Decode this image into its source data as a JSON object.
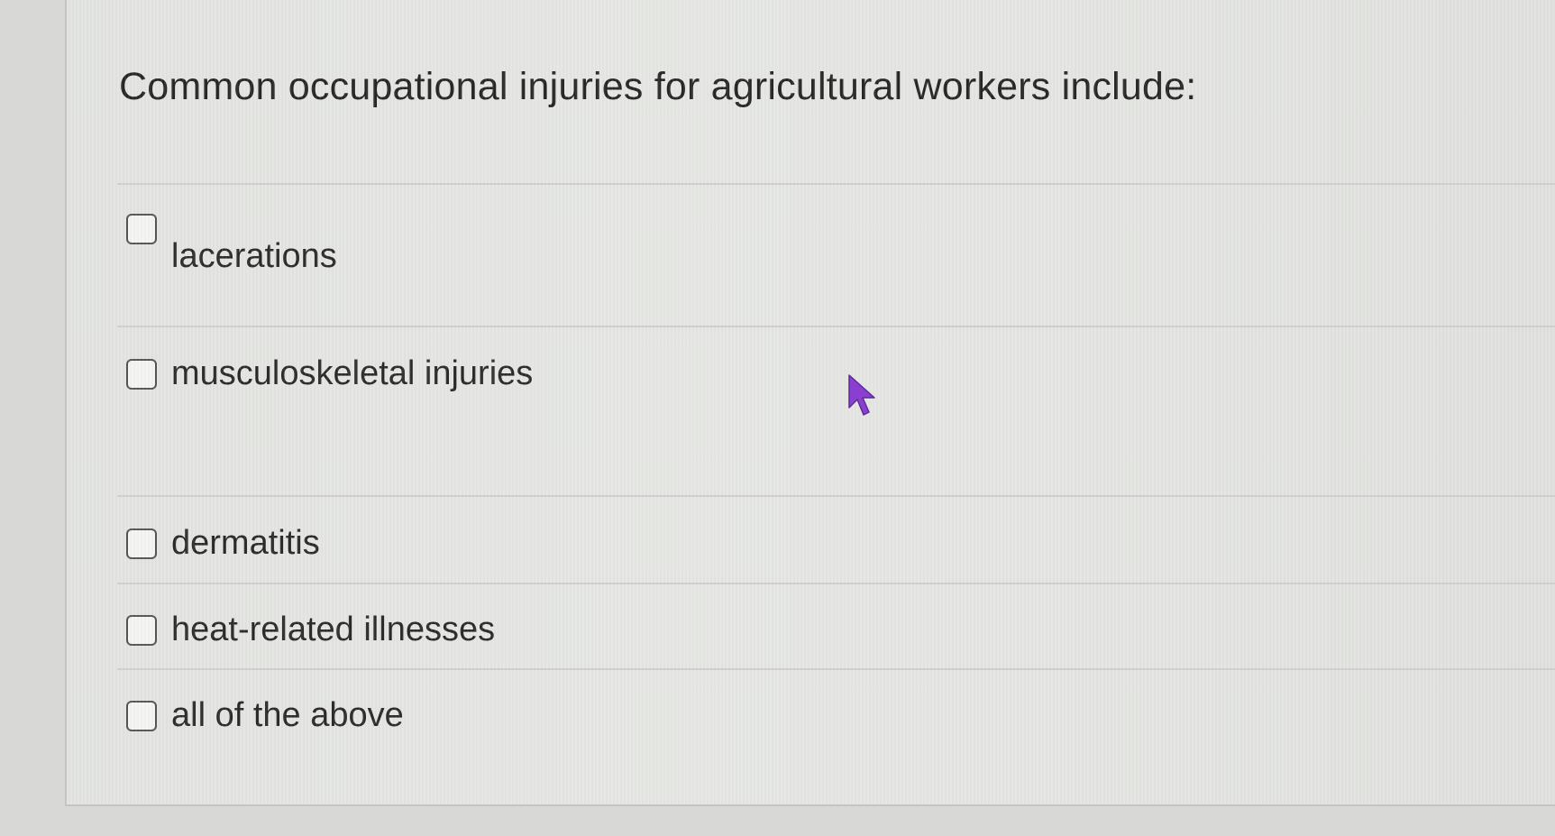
{
  "question": {
    "text": "Common occupational injuries for agricultural workers include:"
  },
  "options": [
    {
      "label": "lacerations",
      "checked": false
    },
    {
      "label": "musculoskeletal injuries",
      "checked": false
    },
    {
      "label": "dermatitis",
      "checked": false
    },
    {
      "label": "heat-related illnesses",
      "checked": false
    },
    {
      "label": "all of the above",
      "checked": false
    }
  ],
  "colors": {
    "cursor": "#8a3fd1"
  }
}
